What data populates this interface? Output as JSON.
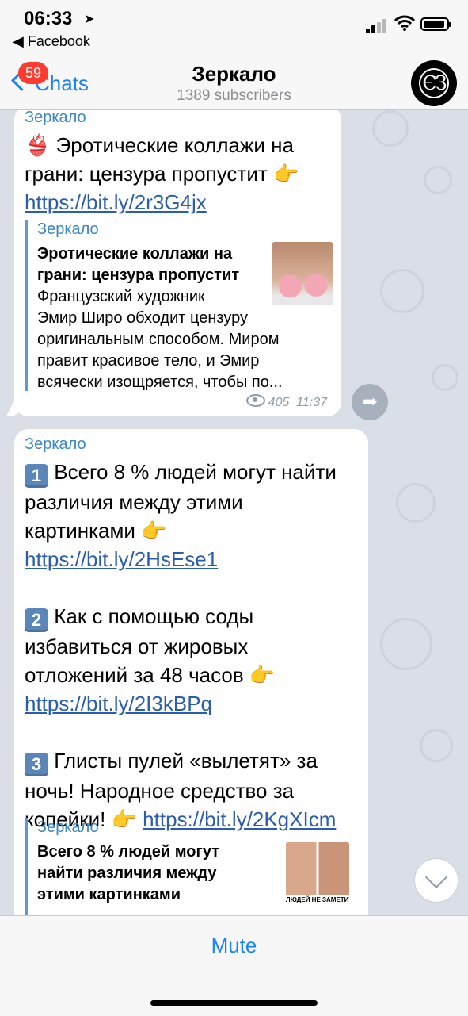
{
  "status": {
    "time": "06:33",
    "back_app": "◀ Facebook"
  },
  "nav": {
    "back_label": "Chats",
    "badge": "59",
    "title": "Зеркало",
    "subtitle": "1389 subscribers",
    "avatar_text": "ЄЗ"
  },
  "messages": [
    {
      "sender": "Зеркало",
      "emoji": "👙",
      "text_line1": " Эротические коллажи на",
      "text_line2": "грани: цензура пропустит ",
      "link": "https://bit.ly/2r3G4jx",
      "preview": {
        "site": "Зеркало",
        "title_l1": "Эротические коллажи на",
        "title_l2": "грани: цензура пропустит",
        "desc_l1": "Французский художник",
        "desc_l2": "Эмир Широ обходит цензуру",
        "desc_l3": "оригинальным способом. Миром",
        "desc_l4": "правит красивое тело, и Эмир",
        "desc_l5": "всячески изощряется, чтобы по..."
      },
      "views": "405",
      "time": "11:37"
    },
    {
      "sender": "Зеркало",
      "item1_num": "1",
      "item1_l1": " Всего 8 % людей могут найти",
      "item1_l2": "различия между этими",
      "item1_l3": "картинками ",
      "item1_link": "https://bit.ly/2HsEse1",
      "item2_num": "2",
      "item2_l1": " Как с помощью соды",
      "item2_l2": "избавиться от жировых",
      "item2_l3": "отложений за 48 часов ",
      "item2_link": "https://bit.ly/2I3kBPq",
      "item3_num": "3",
      "item3_l1": " Глисты пулей «вылетят» за",
      "item3_l2": "ночь! Народное средство за",
      "item3_l3": "копейки! ",
      "item3_link": "https://bit.ly/2KgXIcm",
      "preview": {
        "site": "Зеркало",
        "title_l1": "Всего 8 % людей могут",
        "title_l2": "найти различия между",
        "title_l3": "этими картинками",
        "thumb_caption": "ЛЮДЕЙ НЕ ЗАМЕТИТ РАЗ"
      }
    }
  ],
  "pointing_emoji": "👉",
  "bottom": {
    "mute_label": "Mute"
  },
  "colors": {
    "accent": "#1a82fb",
    "link": "#2a5db0",
    "sender": "#3b86c5",
    "badge": "#ff3b30"
  }
}
